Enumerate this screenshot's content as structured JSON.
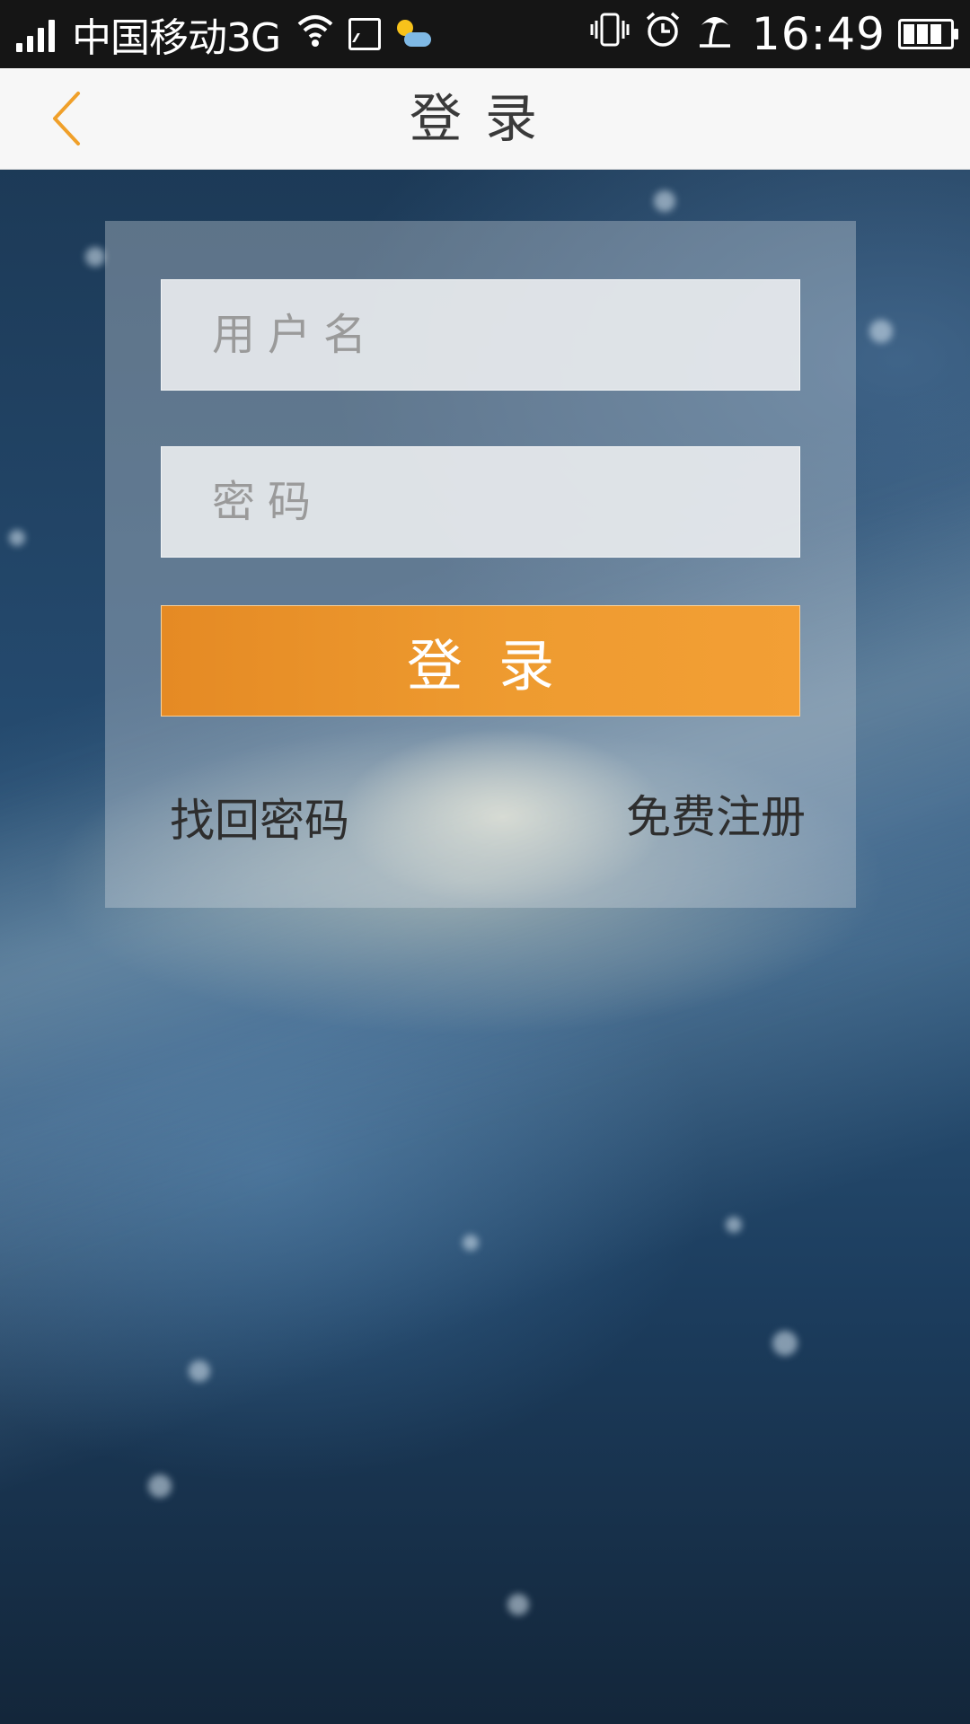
{
  "status_bar": {
    "carrier": "中国移动3G",
    "time": "16:49",
    "icons": [
      "signal-icon",
      "wifi-icon",
      "image-icon",
      "weather-icon",
      "vibrate-icon",
      "alarm-icon",
      "beach-icon",
      "battery-icon"
    ]
  },
  "header": {
    "back_icon": "chevron-left-icon",
    "title": "登录"
  },
  "form": {
    "username": {
      "placeholder": "用户名",
      "value": ""
    },
    "password": {
      "placeholder": "密码",
      "value": ""
    },
    "login_label": "登录",
    "forgot_label": "找回密码",
    "register_label": "免费注册"
  },
  "colors": {
    "accent": "#f19a30",
    "back_icon": "#f0a02a",
    "header_bg": "#f7f7f7",
    "status_bar_bg": "#151515"
  }
}
